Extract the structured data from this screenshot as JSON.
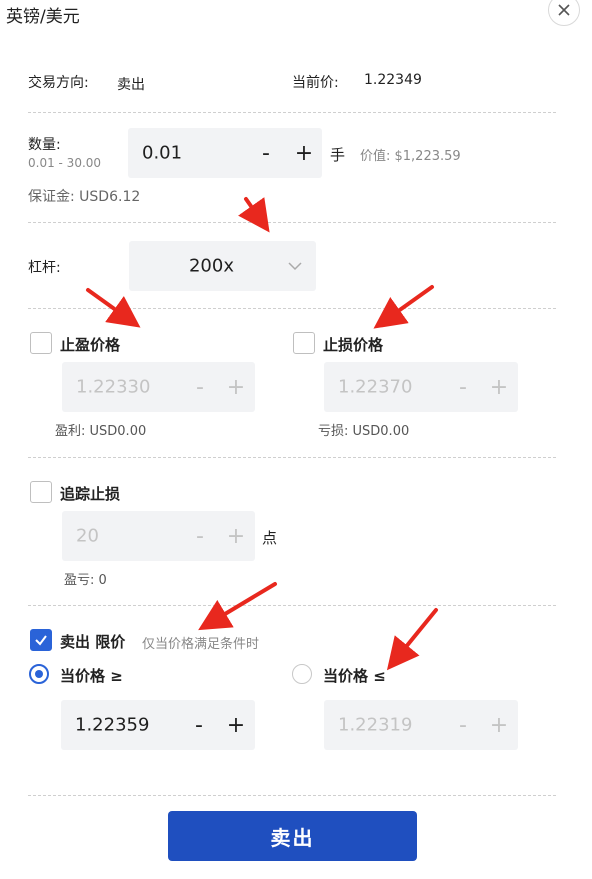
{
  "header": {
    "title": "英镑/美元"
  },
  "info": {
    "direction_label": "交易方向:",
    "direction_value": "卖出",
    "price_label": "当前价:",
    "price_value": "1.22349"
  },
  "volume": {
    "label": "数量:",
    "range": "0.01 - 30.00",
    "value": "0.01",
    "unit": "手",
    "worth": "价值: $1,223.59",
    "margin": "保证金: USD6.12"
  },
  "leverage": {
    "label": "杠杆:",
    "value": "200x"
  },
  "take_profit": {
    "label": "止盈价格",
    "value": "1.22330",
    "profit": "盈利: USD0.00",
    "checked": false
  },
  "stop_loss": {
    "label": "止损价格",
    "value": "1.22370",
    "loss": "亏损: USD0.00",
    "checked": false
  },
  "trailing": {
    "label": "追踪止损",
    "value": "20",
    "unit": "点",
    "pnl": "盈亏: 0",
    "checked": false
  },
  "limit": {
    "label": "卖出 限价",
    "hint": "仅当价格满足条件时",
    "checked": true,
    "option_ge": {
      "label": "当价格 ≥",
      "value": "1.22359",
      "selected": true
    },
    "option_le": {
      "label": "当价格 ≤",
      "value": "1.22319",
      "selected": false
    }
  },
  "buttons": {
    "minus": "-",
    "plus": "+",
    "submit": "卖出"
  },
  "colors": {
    "accent": "#2a63d8",
    "submit": "#1f4fbf",
    "annotation": "#e8281e",
    "field_bg": "#f2f3f5"
  }
}
